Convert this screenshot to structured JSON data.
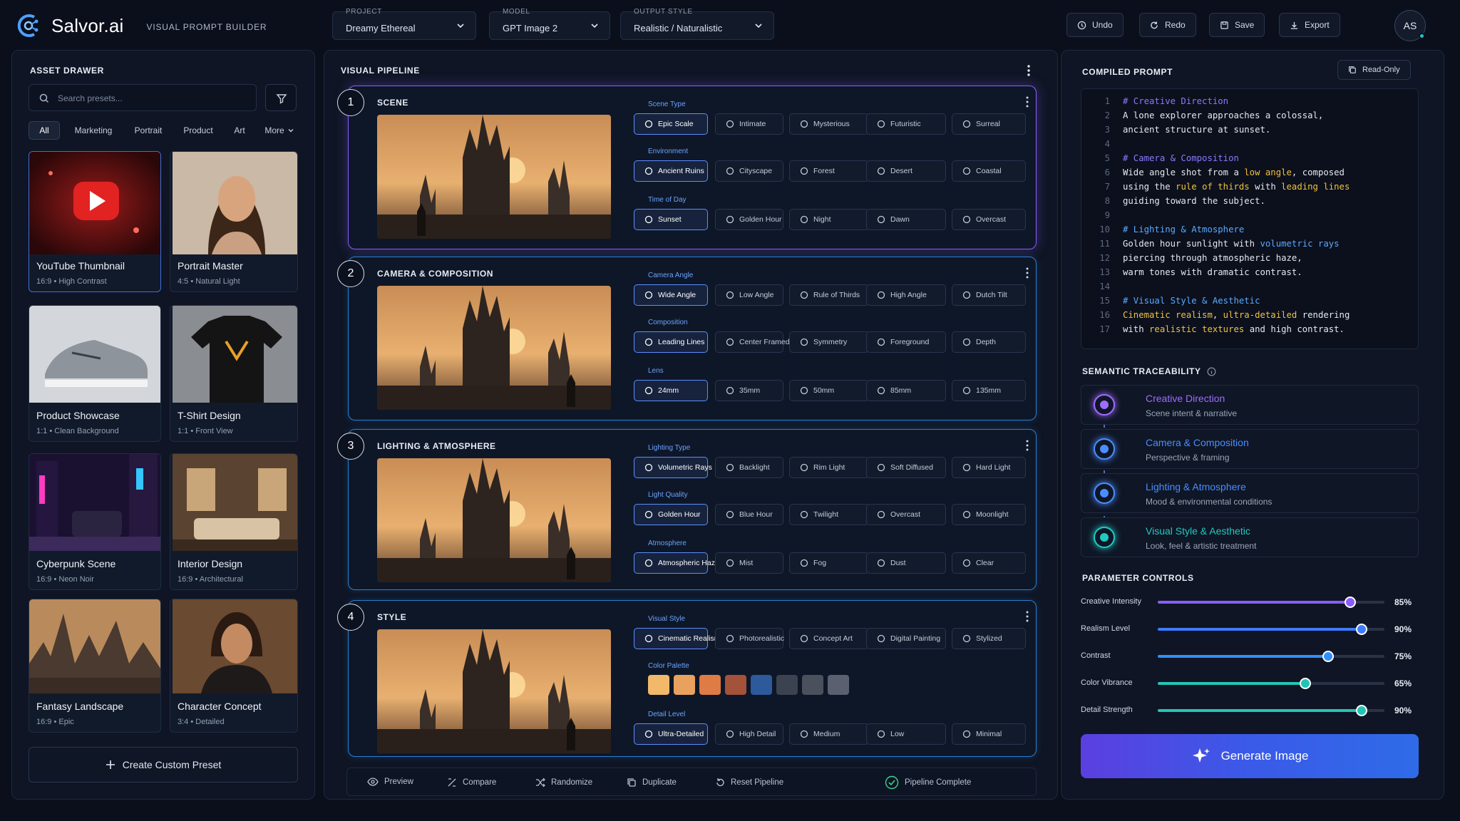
{
  "app": {
    "name": "Salvor.ai",
    "subtitle": "VISUAL PROMPT BUILDER"
  },
  "header": {
    "project": {
      "label": "PROJECT",
      "value": "Dreamy Ethereal"
    },
    "model": {
      "label": "MODEL",
      "value": "GPT Image 2"
    },
    "output_style": {
      "label": "OUTPUT STYLE",
      "value": "Realistic / Naturalistic"
    },
    "undo": "Undo",
    "redo": "Redo",
    "save": "Save",
    "export": "Export",
    "avatar": "AS"
  },
  "asset_drawer": {
    "title": "ASSET DRAWER",
    "search_placeholder": "Search presets...",
    "filters": [
      "All",
      "Marketing",
      "Portrait",
      "Product",
      "Art",
      "More"
    ],
    "cards": [
      {
        "title": "YouTube Thumbnail",
        "meta": "16:9  •  High Contrast"
      },
      {
        "title": "Portrait Master",
        "meta": "4:5  •  Natural Light"
      },
      {
        "title": "Product Showcase",
        "meta": "1:1  •  Clean Background"
      },
      {
        "title": "T-Shirt Design",
        "meta": "1:1  •  Front View"
      },
      {
        "title": "Cyberpunk Scene",
        "meta": "16:9  •  Neon Noir"
      },
      {
        "title": "Interior Design",
        "meta": "16:9  •  Architectural"
      },
      {
        "title": "Fantasy Landscape",
        "meta": "16:9  •  Epic"
      },
      {
        "title": "Character Concept",
        "meta": "3:4  •  Detailed"
      }
    ],
    "create_button": "Create Custom Preset"
  },
  "pipeline": {
    "title": "VISUAL PIPELINE",
    "steps": [
      {
        "num": "1",
        "title": "SCENE",
        "groups": [
          {
            "label": "Scene Type",
            "options": [
              "Epic Scale",
              "Intimate",
              "Mysterious",
              "Futuristic",
              "Surreal"
            ]
          },
          {
            "label": "Environment",
            "options": [
              "Ancient Ruins",
              "Cityscape",
              "Forest",
              "Desert",
              "Coastal"
            ]
          },
          {
            "label": "Time of Day",
            "options": [
              "Sunset",
              "Golden Hour",
              "Night",
              "Dawn",
              "Overcast"
            ]
          }
        ]
      },
      {
        "num": "2",
        "title": "CAMERA & COMPOSITION",
        "groups": [
          {
            "label": "Camera Angle",
            "options": [
              "Wide Angle",
              "Low Angle",
              "Rule of Thirds",
              "High Angle",
              "Dutch Tilt"
            ]
          },
          {
            "label": "Composition",
            "options": [
              "Leading Lines",
              "Center Framed",
              "Symmetry",
              "Foreground",
              "Depth"
            ]
          },
          {
            "label": "Lens",
            "options": [
              "24mm",
              "35mm",
              "50mm",
              "85mm",
              "135mm"
            ]
          }
        ]
      },
      {
        "num": "3",
        "title": "LIGHTING & ATMOSPHERE",
        "groups": [
          {
            "label": "Lighting Type",
            "options": [
              "Volumetric Rays",
              "Backlight",
              "Rim Light",
              "Soft Diffused",
              "Hard Light"
            ]
          },
          {
            "label": "Light Quality",
            "options": [
              "Golden Hour",
              "Blue Hour",
              "Twilight",
              "Overcast",
              "Moonlight"
            ]
          },
          {
            "label": "Atmosphere",
            "options": [
              "Atmospheric Haze",
              "Mist",
              "Fog",
              "Dust",
              "Clear"
            ]
          }
        ]
      },
      {
        "num": "4",
        "title": "STYLE",
        "groups": [
          {
            "label": "Visual Style",
            "options": [
              "Cinematic Realism",
              "Photorealistic",
              "Concept Art",
              "Digital Painting",
              "Stylized"
            ]
          },
          {
            "label": "Color Palette",
            "colors": [
              "#f2b96a",
              "#e9a25d",
              "#df7b45",
              "#a4523a",
              "#2c5a9a",
              "#3b4250",
              "#4a505c",
              "#5a6070"
            ]
          },
          {
            "label": "Detail Level",
            "options": [
              "Ultra-Detailed",
              "High Detail",
              "Medium",
              "Low",
              "Minimal"
            ]
          }
        ]
      }
    ],
    "bottom": {
      "preview": "Preview",
      "compare": "Compare",
      "randomize": "Randomize",
      "duplicate": "Duplicate",
      "reset": "Reset Pipeline",
      "complete": "Pipeline Complete"
    }
  },
  "compiled": {
    "title": "COMPILED PROMPT",
    "readonly": "Read-Only",
    "lines": [
      {
        "n": "1",
        "parts": [
          {
            "t": "# Creative Direction",
            "c": "cm2"
          }
        ]
      },
      {
        "n": "2",
        "parts": [
          {
            "t": "A lone explorer approaches a colossal,"
          }
        ]
      },
      {
        "n": "3",
        "parts": [
          {
            "t": "ancient structure at sunset."
          }
        ]
      },
      {
        "n": "4",
        "parts": []
      },
      {
        "n": "5",
        "parts": [
          {
            "t": "# Camera & Composition",
            "c": "cm2"
          }
        ]
      },
      {
        "n": "6",
        "parts": [
          {
            "t": "Wide angle shot from a "
          },
          {
            "t": "low angle",
            "c": "hl"
          },
          {
            "t": ", composed"
          }
        ]
      },
      {
        "n": "7",
        "parts": [
          {
            "t": "using the "
          },
          {
            "t": "rule of thirds",
            "c": "hl"
          },
          {
            "t": " with "
          },
          {
            "t": "leading lines",
            "c": "hl"
          }
        ]
      },
      {
        "n": "8",
        "parts": [
          {
            "t": "guiding toward the subject."
          }
        ]
      },
      {
        "n": "9",
        "parts": []
      },
      {
        "n": "10",
        "parts": [
          {
            "t": "# Lighting & Atmosphere",
            "c": "hb"
          }
        ]
      },
      {
        "n": "11",
        "parts": [
          {
            "t": "Golden hour sunlight with "
          },
          {
            "t": "volumetric rays",
            "c": "hb"
          }
        ]
      },
      {
        "n": "12",
        "parts": [
          {
            "t": "piercing through atmospheric haze,"
          }
        ]
      },
      {
        "n": "13",
        "parts": [
          {
            "t": "warm tones with dramatic contrast."
          }
        ]
      },
      {
        "n": "14",
        "parts": []
      },
      {
        "n": "15",
        "parts": [
          {
            "t": "# Visual Style & Aesthetic",
            "c": "hb"
          }
        ]
      },
      {
        "n": "16",
        "parts": [
          {
            "t": "Cinematic realism",
            "c": "hl"
          },
          {
            "t": ", "
          },
          {
            "t": "ultra-detailed",
            "c": "hl"
          },
          {
            "t": " rendering"
          }
        ]
      },
      {
        "n": "17",
        "parts": [
          {
            "t": "with "
          },
          {
            "t": "realistic textures",
            "c": "hl"
          },
          {
            "t": " and high contrast."
          }
        ]
      }
    ]
  },
  "traceability": {
    "title": "SEMANTIC TRACEABILITY",
    "items": [
      {
        "title": "Creative Direction",
        "desc": "Scene intent & narrative",
        "color": "#a06bff"
      },
      {
        "title": "Camera & Composition",
        "desc": "Perspective & framing",
        "color": "#4a8dff"
      },
      {
        "title": "Lighting & Atmosphere",
        "desc": "Mood & environmental conditions",
        "color": "#4a8dff"
      },
      {
        "title": "Visual Style & Aesthetic",
        "desc": "Look, feel & artistic treatment",
        "color": "#22c9c0"
      }
    ]
  },
  "parameters": {
    "title": "PARAMETER CONTROLS",
    "items": [
      {
        "label": "Creative Intensity",
        "value": "85%",
        "level": 0.85,
        "color": "#8a5cff"
      },
      {
        "label": "Realism Level",
        "value": "90%",
        "level": 0.9,
        "color": "#3d7cff"
      },
      {
        "label": "Contrast",
        "value": "75%",
        "level": 0.75,
        "color": "#2f8fff"
      },
      {
        "label": "Color Vibrance",
        "value": "65%",
        "level": 0.65,
        "color": "#22c4b6"
      },
      {
        "label": "Detail Strength",
        "value": "90%",
        "level": 0.9,
        "color": "#22c4b6"
      }
    ]
  },
  "generate": "Generate Image"
}
